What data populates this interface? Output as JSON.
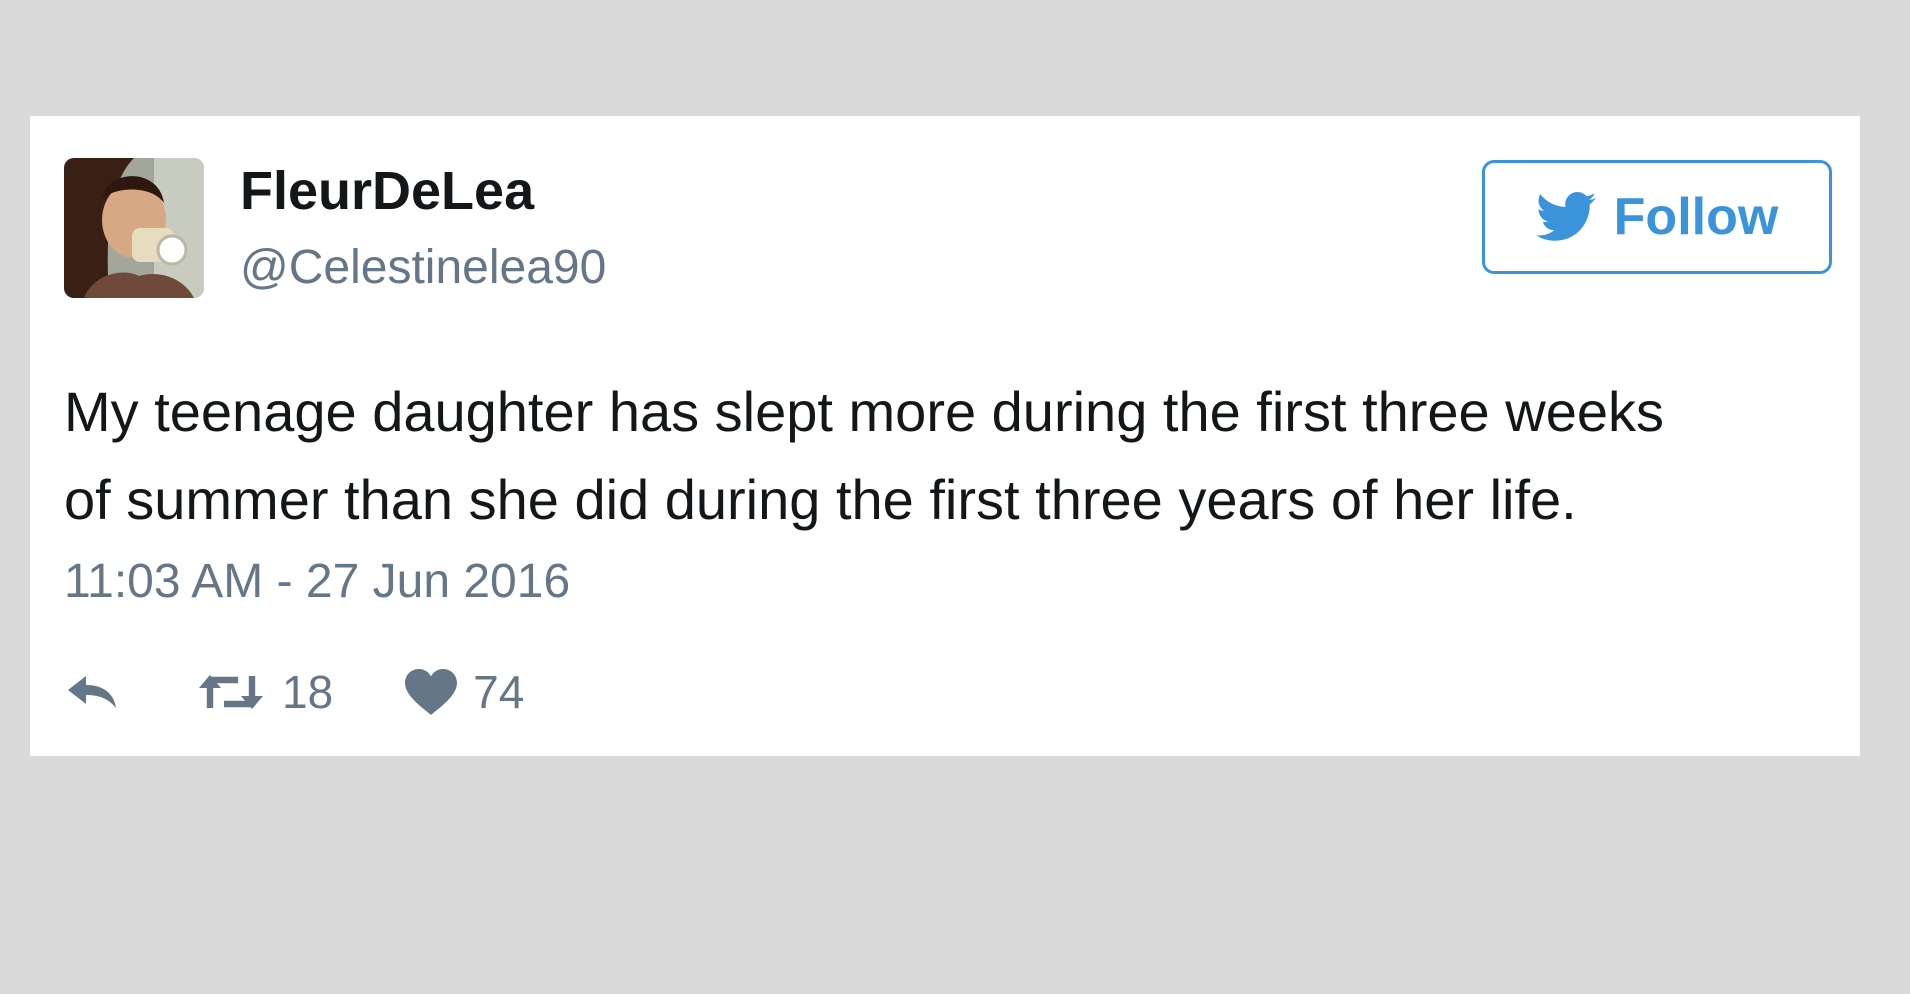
{
  "tweet": {
    "display_name": "FleurDeLea",
    "handle": "@Celestinelea90",
    "follow_label": "Follow",
    "text_lines": [
      "My teenage daughter has slept more during the first three weeks",
      "of summer than she did during the first three years of her life."
    ],
    "timestamp": "11:03 AM - 27 Jun 2016",
    "retweet_count": "18",
    "like_count": "74"
  },
  "icons": {
    "follow": "twitter-bird-icon",
    "reply": "reply-icon",
    "retweet": "retweet-icon",
    "like": "heart-icon"
  },
  "colors": {
    "accent": "#3b94d9",
    "text": "#14171a",
    "secondary_text": "#657786",
    "background": "#d9d9d9",
    "card": "#ffffff"
  }
}
